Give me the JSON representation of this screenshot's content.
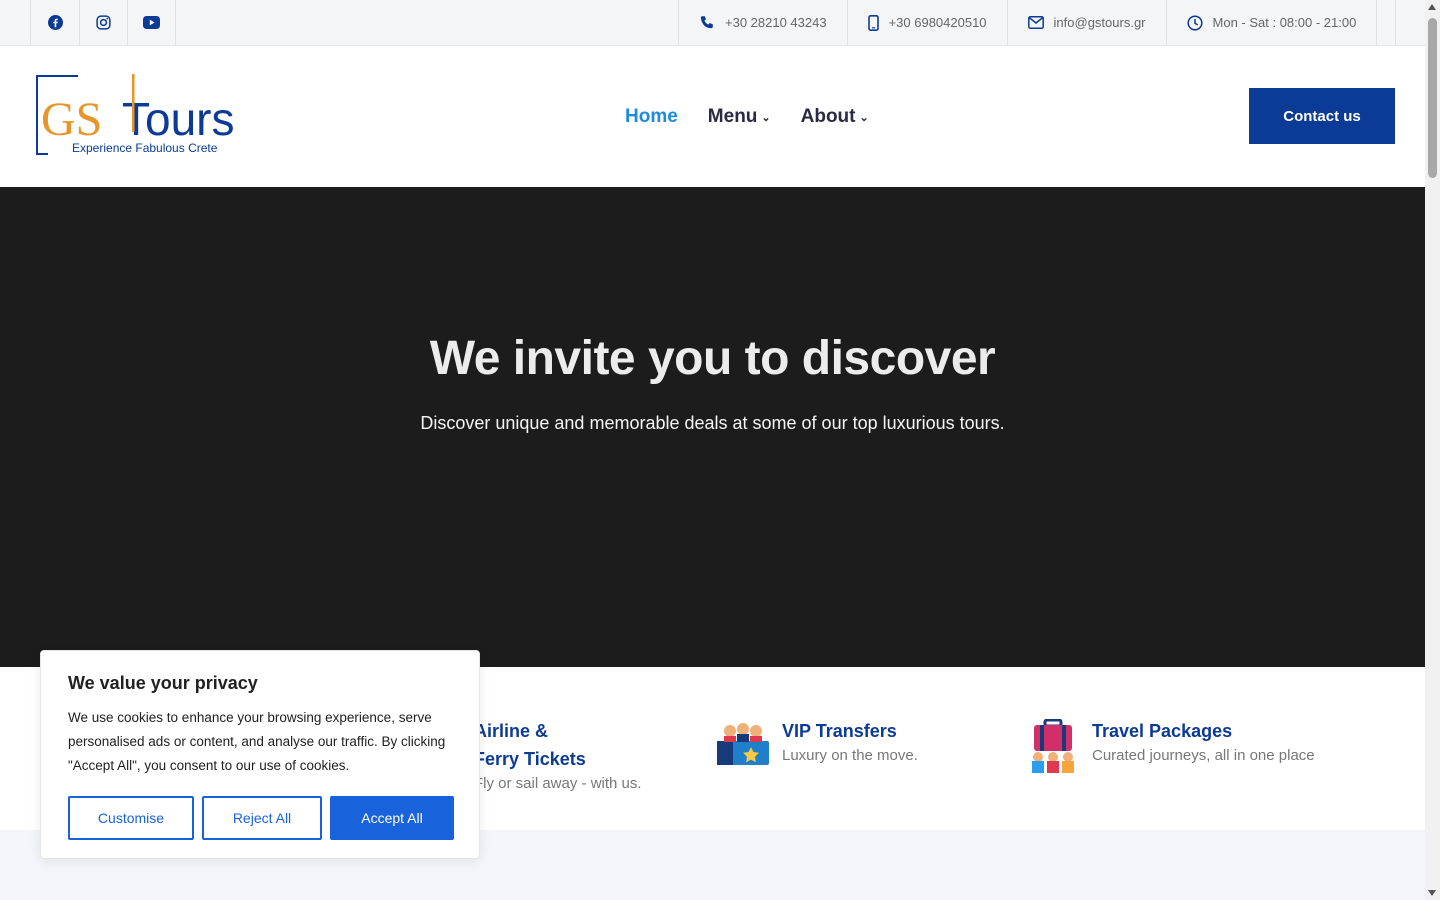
{
  "topbar": {
    "social": [
      {
        "name": "facebook-icon"
      },
      {
        "name": "instagram-icon"
      },
      {
        "name": "youtube-icon"
      }
    ],
    "phone": "+30 28210 43243",
    "mobile": "+30 6980420510",
    "email": "info@gstours.gr",
    "hours": "Mon - Sat : 08:00 - 21:00"
  },
  "logo": {
    "brand_gs": "GS",
    "brand_tours": "Tours",
    "tagline": "Experience Fabulous Crete"
  },
  "nav": {
    "home": "Home",
    "menu": "Menu",
    "about": "About"
  },
  "contact_button": "Contact us",
  "hero": {
    "title": "We invite you to discover",
    "subtitle": "Discover unique and memorable deals at some of our top luxurious tours."
  },
  "services": [
    {
      "title_line1": "Airline &",
      "title_line2": "Ferry Tickets",
      "desc": "Fly or sail away - with us."
    },
    {
      "title": "VIP Transfers",
      "desc": "Luxury on the move."
    },
    {
      "title": "Travel Packages",
      "desc": "Curated journeys, all in one place"
    }
  ],
  "cookie": {
    "title": "We value your privacy",
    "text": "We use cookies to enhance your browsing experience, serve personalised ads or content, and analyse our traffic. By clicking \"Accept All\", you consent to our use of cookies.",
    "customise": "Customise",
    "reject": "Reject All",
    "accept": "Accept All"
  },
  "colors": {
    "brand_blue": "#0b3b96",
    "brand_orange": "#e8962a",
    "nav_active": "#1e8be0",
    "cookie_blue": "#1863dc",
    "hero_bg": "#1c1c1d"
  }
}
